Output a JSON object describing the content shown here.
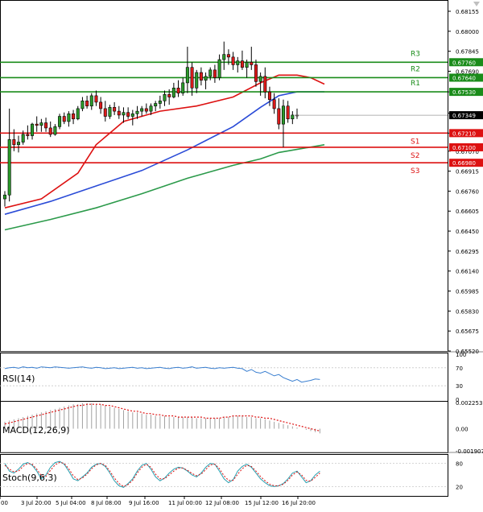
{
  "chart_data": {
    "type": "candlestick",
    "instrument_panel": {
      "price_ticks": [
        "0.68155",
        "0.68000",
        "0.67845",
        "0.67690",
        "0.67530",
        "0.67365",
        "0.67210",
        "0.67070",
        "0.66915",
        "0.66760",
        "0.66605",
        "0.66450",
        "0.66295",
        "0.66140",
        "0.65985",
        "0.65830",
        "0.65675",
        "0.65520"
      ],
      "price_range": [
        0.6552,
        0.6823
      ],
      "current_price": "0.67349",
      "levels": [
        {
          "name": "R3",
          "value": 0.6776,
          "label": "0.67760",
          "color": "#1a8c1a"
        },
        {
          "name": "R2",
          "value": 0.6764,
          "label": "0.67640",
          "color": "#1a8c1a"
        },
        {
          "name": "R1",
          "value": 0.6753,
          "label": "0.67530",
          "color": "#1a8c1a"
        },
        {
          "name": "S1",
          "value": 0.6721,
          "label": "0.67210",
          "color": "#dd1111"
        },
        {
          "name": "S2",
          "value": 0.671,
          "label": "0.67100",
          "color": "#dd1111"
        },
        {
          "name": "S3",
          "value": 0.6698,
          "label": "0.66980",
          "color": "#dd1111"
        }
      ],
      "ma_series": [
        {
          "color": "#dd1111",
          "points": [
            [
              0,
              0.6663
            ],
            [
              8,
              0.667
            ],
            [
              16,
              0.669
            ],
            [
              20,
              0.6712
            ],
            [
              26,
              0.673
            ],
            [
              34,
              0.6738
            ],
            [
              42,
              0.6742
            ],
            [
              50,
              0.6749
            ],
            [
              56,
              0.676
            ],
            [
              60,
              0.6766
            ],
            [
              64,
              0.6766
            ],
            [
              67,
              0.6764
            ],
            [
              70,
              0.6759
            ]
          ]
        },
        {
          "color": "#2a4bd7",
          "points": [
            [
              0,
              0.6658
            ],
            [
              10,
              0.6668
            ],
            [
              20,
              0.668
            ],
            [
              30,
              0.6692
            ],
            [
              40,
              0.6708
            ],
            [
              50,
              0.6726
            ],
            [
              56,
              0.6741
            ],
            [
              60,
              0.675
            ],
            [
              64,
              0.6753
            ],
            [
              70,
              0.6753
            ]
          ]
        },
        {
          "color": "#2b9a4a",
          "points": [
            [
              0,
              0.6646
            ],
            [
              10,
              0.6654
            ],
            [
              20,
              0.6663
            ],
            [
              30,
              0.6674
            ],
            [
              40,
              0.6686
            ],
            [
              50,
              0.6696
            ],
            [
              56,
              0.6701
            ],
            [
              60,
              0.6706
            ],
            [
              65,
              0.6709
            ],
            [
              70,
              0.6712
            ]
          ]
        }
      ],
      "candles": [
        [
          0.667,
          0.6676,
          0.6664,
          0.6673
        ],
        [
          0.6673,
          0.674,
          0.6668,
          0.6716
        ],
        [
          0.6716,
          0.6724,
          0.6707,
          0.6712
        ],
        [
          0.6712,
          0.6719,
          0.6706,
          0.6714
        ],
        [
          0.6714,
          0.6723,
          0.6712,
          0.672
        ],
        [
          0.672,
          0.6727,
          0.6716,
          0.6719
        ],
        [
          0.6719,
          0.6729,
          0.6716,
          0.6728
        ],
        [
          0.6728,
          0.6734,
          0.6722,
          0.6727
        ],
        [
          0.6727,
          0.6732,
          0.6722,
          0.6729
        ],
        [
          0.6729,
          0.6733,
          0.6722,
          0.6725
        ],
        [
          0.6725,
          0.673,
          0.6718,
          0.672
        ],
        [
          0.672,
          0.6728,
          0.6719,
          0.6726
        ],
        [
          0.6726,
          0.6736,
          0.6724,
          0.6734
        ],
        [
          0.6734,
          0.6737,
          0.6728,
          0.673
        ],
        [
          0.673,
          0.6738,
          0.6726,
          0.6736
        ],
        [
          0.6736,
          0.6739,
          0.6728,
          0.6732
        ],
        [
          0.6732,
          0.6742,
          0.6731,
          0.674
        ],
        [
          0.674,
          0.6749,
          0.6738,
          0.6746
        ],
        [
          0.6746,
          0.675,
          0.674,
          0.6742
        ],
        [
          0.6742,
          0.6752,
          0.6739,
          0.675
        ],
        [
          0.675,
          0.6754,
          0.6742,
          0.6745
        ],
        [
          0.6745,
          0.6749,
          0.6736,
          0.674
        ],
        [
          0.674,
          0.6746,
          0.673,
          0.6734
        ],
        [
          0.6734,
          0.6743,
          0.6732,
          0.6741
        ],
        [
          0.6741,
          0.6745,
          0.6735,
          0.6738
        ],
        [
          0.6738,
          0.6742,
          0.6732,
          0.6735
        ],
        [
          0.6735,
          0.6741,
          0.6729,
          0.6737
        ],
        [
          0.6737,
          0.6741,
          0.6732,
          0.6734
        ],
        [
          0.6734,
          0.6739,
          0.6727,
          0.6736
        ],
        [
          0.6736,
          0.6742,
          0.6732,
          0.6738
        ],
        [
          0.6738,
          0.6742,
          0.6734,
          0.674
        ],
        [
          0.674,
          0.6744,
          0.6736,
          0.6738
        ],
        [
          0.6738,
          0.6744,
          0.6735,
          0.6742
        ],
        [
          0.6742,
          0.6746,
          0.6738,
          0.6744
        ],
        [
          0.6744,
          0.675,
          0.674,
          0.6746
        ],
        [
          0.6746,
          0.6754,
          0.6742,
          0.6751
        ],
        [
          0.6751,
          0.6755,
          0.6743,
          0.6749
        ],
        [
          0.6749,
          0.676,
          0.6748,
          0.6756
        ],
        [
          0.6756,
          0.6762,
          0.6749,
          0.6752
        ],
        [
          0.6752,
          0.6764,
          0.675,
          0.676
        ],
        [
          0.676,
          0.6788,
          0.6752,
          0.6772
        ],
        [
          0.6772,
          0.6776,
          0.675,
          0.6756
        ],
        [
          0.6756,
          0.677,
          0.6752,
          0.6768
        ],
        [
          0.6768,
          0.6772,
          0.6758,
          0.6762
        ],
        [
          0.6762,
          0.6768,
          0.6755,
          0.6765
        ],
        [
          0.6765,
          0.6772,
          0.6762,
          0.677
        ],
        [
          0.677,
          0.6774,
          0.676,
          0.6764
        ],
        [
          0.6764,
          0.6782,
          0.6762,
          0.6778
        ],
        [
          0.6778,
          0.6792,
          0.677,
          0.6782
        ],
        [
          0.6782,
          0.6786,
          0.6774,
          0.678
        ],
        [
          0.678,
          0.6784,
          0.677,
          0.6774
        ],
        [
          0.6774,
          0.678,
          0.6768,
          0.6777
        ],
        [
          0.6777,
          0.6785,
          0.677,
          0.6772
        ],
        [
          0.6772,
          0.6778,
          0.6764,
          0.6776
        ],
        [
          0.6776,
          0.6788,
          0.677,
          0.6774
        ],
        [
          0.6774,
          0.6778,
          0.6757,
          0.6761
        ],
        [
          0.6761,
          0.6768,
          0.675,
          0.6765
        ],
        [
          0.6765,
          0.6772,
          0.6748,
          0.6753
        ],
        [
          0.6753,
          0.6757,
          0.6742,
          0.6747
        ],
        [
          0.6747,
          0.6752,
          0.6736,
          0.674
        ],
        [
          0.674,
          0.6748,
          0.6724,
          0.6728
        ],
        [
          0.6728,
          0.6747,
          0.671,
          0.6742
        ],
        [
          0.6742,
          0.6746,
          0.6729,
          0.6732
        ],
        [
          0.6732,
          0.6738,
          0.6728,
          0.6735
        ],
        [
          0.6735,
          0.674,
          0.6732,
          0.67349
        ]
      ]
    },
    "x_labels": [
      "00",
      "3 Jul 20:00",
      "5 Jul 04:00",
      "8 Jul 08:00",
      "9 Jul 16:00",
      "11 Jul 00:00",
      "12 Jul 08:00",
      "15 Jul 12:00",
      "16 Jul 20:00"
    ],
    "rsi": {
      "label": "RSI(14)",
      "ticks": [
        "100",
        "70",
        "30",
        "0"
      ],
      "range": [
        0,
        100
      ],
      "values": [
        68,
        70,
        71,
        69,
        72,
        70,
        71,
        69,
        72,
        71,
        70,
        72,
        71,
        70,
        69,
        70,
        71,
        72,
        70,
        69,
        71,
        70,
        68,
        69,
        70,
        68,
        69,
        70,
        71,
        69,
        70,
        68,
        69,
        70,
        71,
        69,
        68,
        70,
        71,
        69,
        70,
        72,
        69,
        70,
        71,
        69,
        68,
        70,
        69,
        70,
        71,
        69,
        68,
        62,
        66,
        60,
        58,
        62,
        57,
        52,
        55,
        48,
        44,
        40,
        44,
        38,
        40,
        42,
        45,
        44
      ]
    },
    "macd": {
      "label": "MACD(12,26,9)",
      "ticks": [
        "0.002253",
        "0.00",
        "-0.001907"
      ],
      "range": [
        -0.0019,
        0.00225
      ],
      "histogram": [
        0.0006,
        0.0007,
        0.0008,
        0.0009,
        0.001,
        0.0011,
        0.0012,
        0.0013,
        0.0014,
        0.0015,
        0.0016,
        0.0017,
        0.0018,
        0.0019,
        0.002,
        0.0021,
        0.0021,
        0.0022,
        0.0022,
        0.0022,
        0.0021,
        0.0021,
        0.002,
        0.0019,
        0.0018,
        0.0017,
        0.0016,
        0.0015,
        0.0014,
        0.0014,
        0.0013,
        0.0012,
        0.0012,
        0.0011,
        0.0011,
        0.0011,
        0.001,
        0.001,
        0.001,
        0.001,
        0.001,
        0.001,
        0.0009,
        0.0009,
        0.0009,
        0.0009,
        0.0009,
        0.0009,
        0.001,
        0.001,
        0.0011,
        0.0011,
        0.0011,
        0.001,
        0.001,
        0.0009,
        0.0009,
        0.0008,
        0.0007,
        0.0006,
        0.0005,
        0.0004,
        0.0003,
        0.0002,
        0.0001,
        0.0,
        -0.0001,
        -0.0002,
        -0.0003,
        -0.0004
      ],
      "signal": [
        0.0004,
        0.0005,
        0.0006,
        0.0007,
        0.0008,
        0.0009,
        0.001,
        0.0011,
        0.0012,
        0.0013,
        0.0014,
        0.0015,
        0.0016,
        0.0017,
        0.0018,
        0.0019,
        0.002,
        0.002,
        0.0021,
        0.0021,
        0.0021,
        0.0021,
        0.002,
        0.002,
        0.0019,
        0.0018,
        0.0017,
        0.0016,
        0.0015,
        0.0015,
        0.0014,
        0.0013,
        0.0013,
        0.0012,
        0.0012,
        0.0011,
        0.0011,
        0.0011,
        0.001,
        0.001,
        0.001,
        0.001,
        0.001,
        0.001,
        0.0009,
        0.0009,
        0.0009,
        0.0009,
        0.001,
        0.001,
        0.0011,
        0.0011,
        0.0011,
        0.0011,
        0.0011,
        0.001,
        0.001,
        0.0009,
        0.0009,
        0.0008,
        0.0007,
        0.0006,
        0.0005,
        0.0004,
        0.0003,
        0.0002,
        0.0001,
        0.0,
        -0.0001,
        -0.0002
      ]
    },
    "stoch": {
      "label": "Stoch(9,6,3)",
      "ticks": [
        "80",
        "20"
      ],
      "range": [
        0,
        100
      ],
      "k": [
        80,
        60,
        55,
        65,
        78,
        82,
        75,
        60,
        40,
        50,
        70,
        82,
        85,
        78,
        60,
        40,
        35,
        45,
        55,
        70,
        78,
        80,
        72,
        55,
        35,
        22,
        18,
        28,
        40,
        60,
        75,
        80,
        65,
        45,
        35,
        42,
        55,
        65,
        70,
        68,
        60,
        50,
        45,
        55,
        70,
        80,
        78,
        60,
        40,
        30,
        38,
        60,
        72,
        78,
        70,
        55,
        40,
        30,
        22,
        20,
        22,
        28,
        40,
        55,
        60,
        45,
        30,
        35,
        50,
        60
      ],
      "d": [
        75,
        65,
        58,
        60,
        72,
        80,
        78,
        65,
        48,
        46,
        62,
        76,
        83,
        80,
        66,
        48,
        38,
        42,
        52,
        66,
        76,
        80,
        75,
        60,
        42,
        28,
        20,
        25,
        36,
        55,
        70,
        78,
        70,
        52,
        40,
        40,
        50,
        60,
        68,
        68,
        62,
        54,
        48,
        52,
        64,
        76,
        78,
        66,
        48,
        36,
        36,
        52,
        66,
        75,
        72,
        60,
        46,
        35,
        26,
        22,
        22,
        26,
        36,
        50,
        58,
        50,
        36,
        34,
        44,
        55
      ]
    }
  }
}
